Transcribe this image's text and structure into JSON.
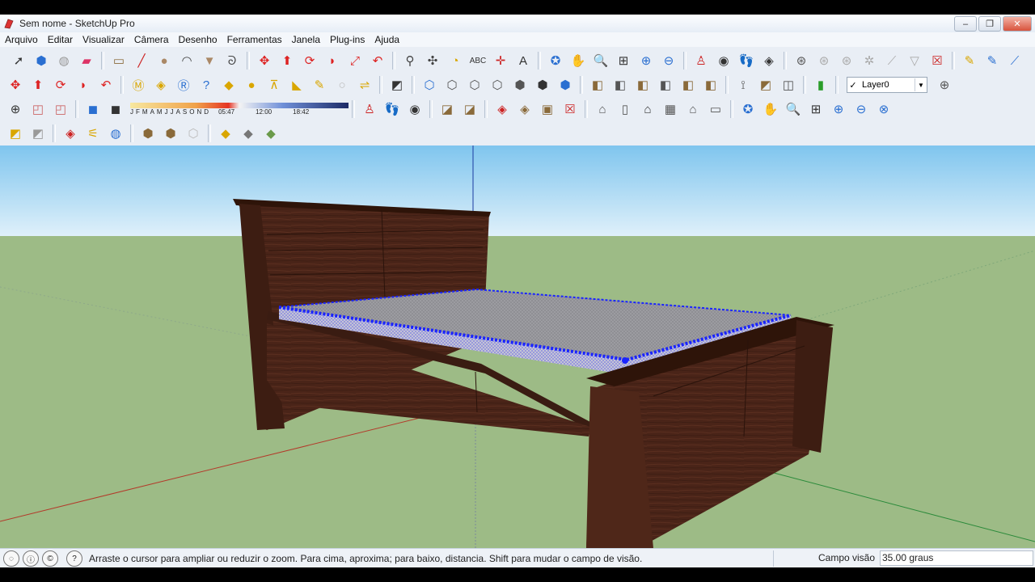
{
  "window": {
    "title": "Sem nome - SketchUp Pro",
    "controls": [
      "‒",
      "❐",
      "✕"
    ]
  },
  "menubar": {
    "items": [
      "Arquivo",
      "Editar",
      "Visualizar",
      "Câmera",
      "Desenho",
      "Ferramentas",
      "Janela",
      "Plug-ins",
      "Ajuda"
    ]
  },
  "toolbar": {
    "layer": {
      "name": "Layer0",
      "visible_check": "✓"
    },
    "shadows": {
      "months": [
        "J",
        "F",
        "M",
        "A",
        "M",
        "J",
        "J",
        "A",
        "S",
        "O",
        "N",
        "D"
      ],
      "times": [
        "05:47",
        "12:00",
        "18:42"
      ]
    }
  },
  "statusbar": {
    "message": "Arraste o cursor para ampliar ou reduzir o zoom. Para cima, aproxima; para baixo, distancia. Shift para mudar o campo de visão.",
    "field_label": "Campo visão",
    "field_value": "35.00 graus"
  },
  "colors": {
    "sky_top": "#7fc5ee",
    "sky_bottom": "#dff0fa",
    "ground": "#9dbb86",
    "wood": "#4a2418",
    "mattress": "#8c8c90",
    "selection": "#1a24ff"
  }
}
